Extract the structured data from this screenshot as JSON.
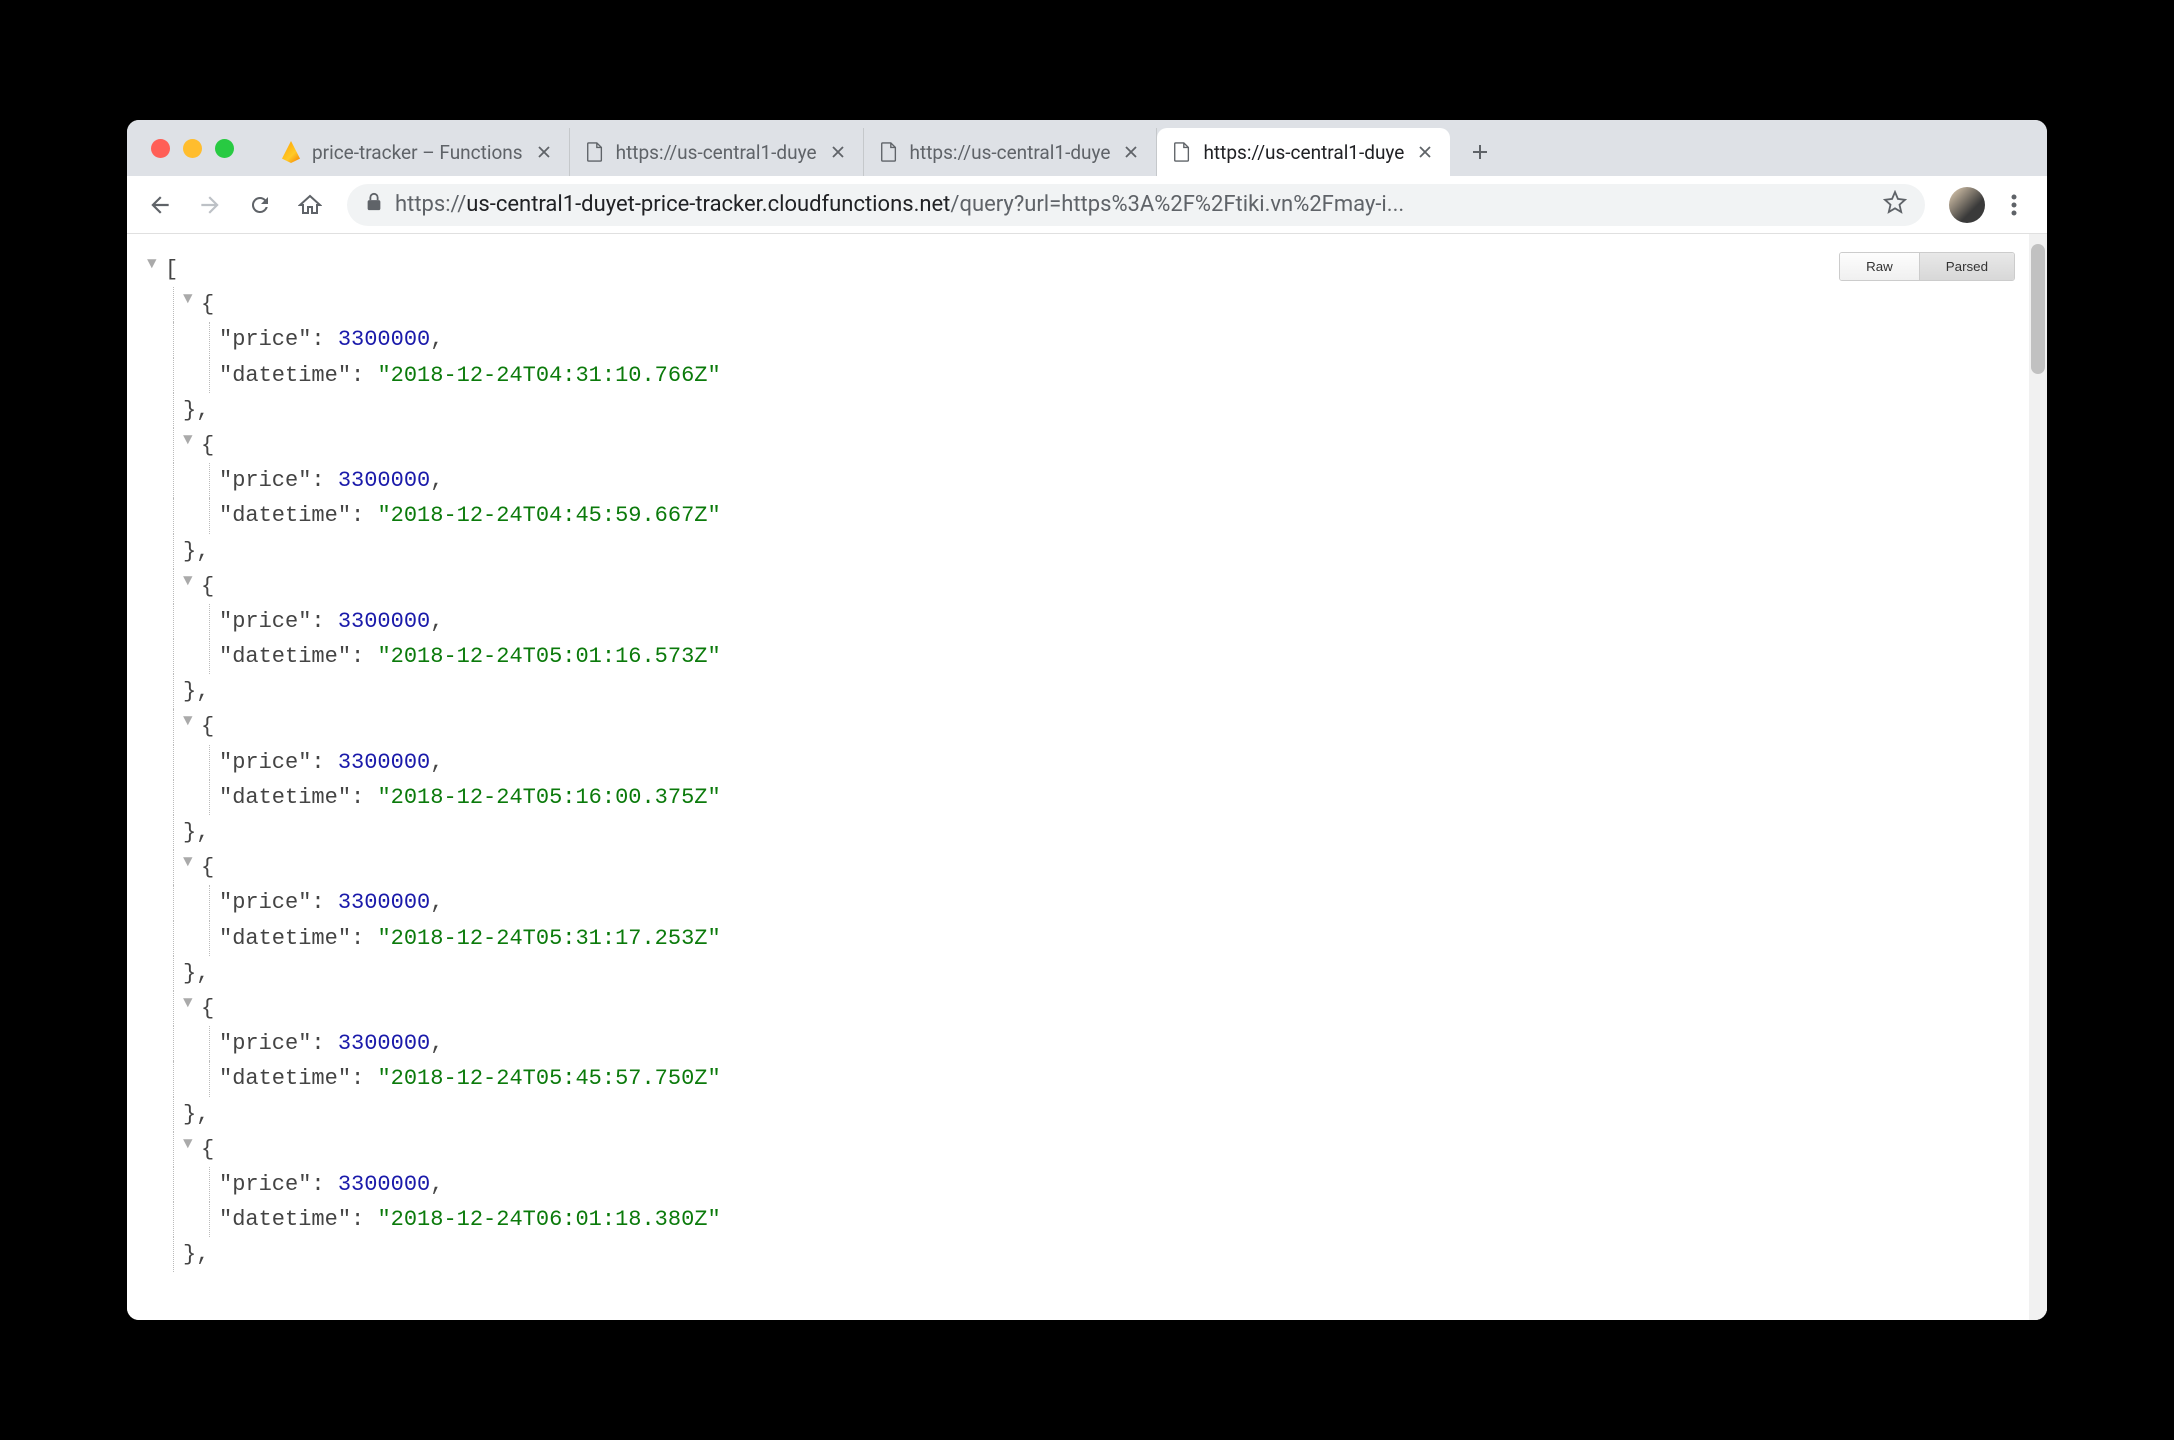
{
  "tabs": {
    "items": [
      {
        "title": "price-tracker – Functions",
        "favicon": "firebase"
      },
      {
        "title": "https://us-central1-duye",
        "favicon": "file"
      },
      {
        "title": "https://us-central1-duye",
        "favicon": "file"
      },
      {
        "title": "https://us-central1-duye",
        "favicon": "file",
        "active": true
      }
    ]
  },
  "address": {
    "scheme": "https://",
    "host": "us-central1-duyet-price-tracker.cloudfunctions.net",
    "path": "/query?url=https%3A%2F%2Ftiki.vn%2Fmay-i..."
  },
  "viewer": {
    "raw_label": "Raw",
    "parsed_label": "Parsed"
  },
  "json_records": [
    {
      "price": 3300000,
      "datetime": "2018-12-24T04:31:10.766Z"
    },
    {
      "price": 3300000,
      "datetime": "2018-12-24T04:45:59.667Z"
    },
    {
      "price": 3300000,
      "datetime": "2018-12-24T05:01:16.573Z"
    },
    {
      "price": 3300000,
      "datetime": "2018-12-24T05:16:00.375Z"
    },
    {
      "price": 3300000,
      "datetime": "2018-12-24T05:31:17.253Z"
    },
    {
      "price": 3300000,
      "datetime": "2018-12-24T05:45:57.750Z"
    },
    {
      "price": 3300000,
      "datetime": "2018-12-24T06:01:18.380Z"
    }
  ],
  "json_keys": {
    "price": "price",
    "datetime": "datetime"
  },
  "glyphs": {
    "bracket_open": "[",
    "brace_open": "{",
    "brace_close_comma": "},",
    "colon_space": ": ",
    "comma": ",",
    "quote": "\""
  }
}
